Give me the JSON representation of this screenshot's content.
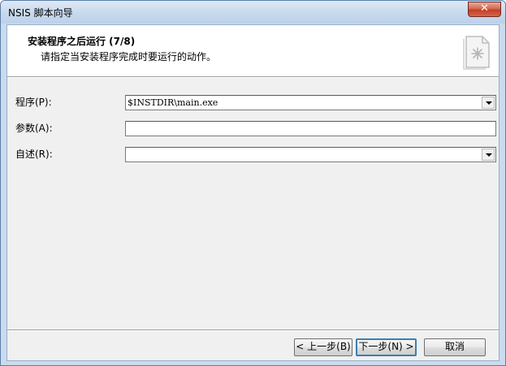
{
  "window": {
    "title": "NSIS 脚本向导",
    "close_glyph": "✕"
  },
  "header": {
    "title": "安装程序之后运行 (7/8)",
    "subtitle": "请指定当安装程序完成时要运行的动作。",
    "icon": "document-sparkle-icon"
  },
  "form": {
    "program_label": "程序(P):",
    "program_value": "$INSTDIR\\main.exe",
    "params_label": "参数(A):",
    "params_value": "",
    "readme_label": "自述(R):",
    "readme_value": ""
  },
  "buttons": {
    "back": "< 上一步(B)",
    "next": "下一步(N) >",
    "cancel": "取消"
  }
}
